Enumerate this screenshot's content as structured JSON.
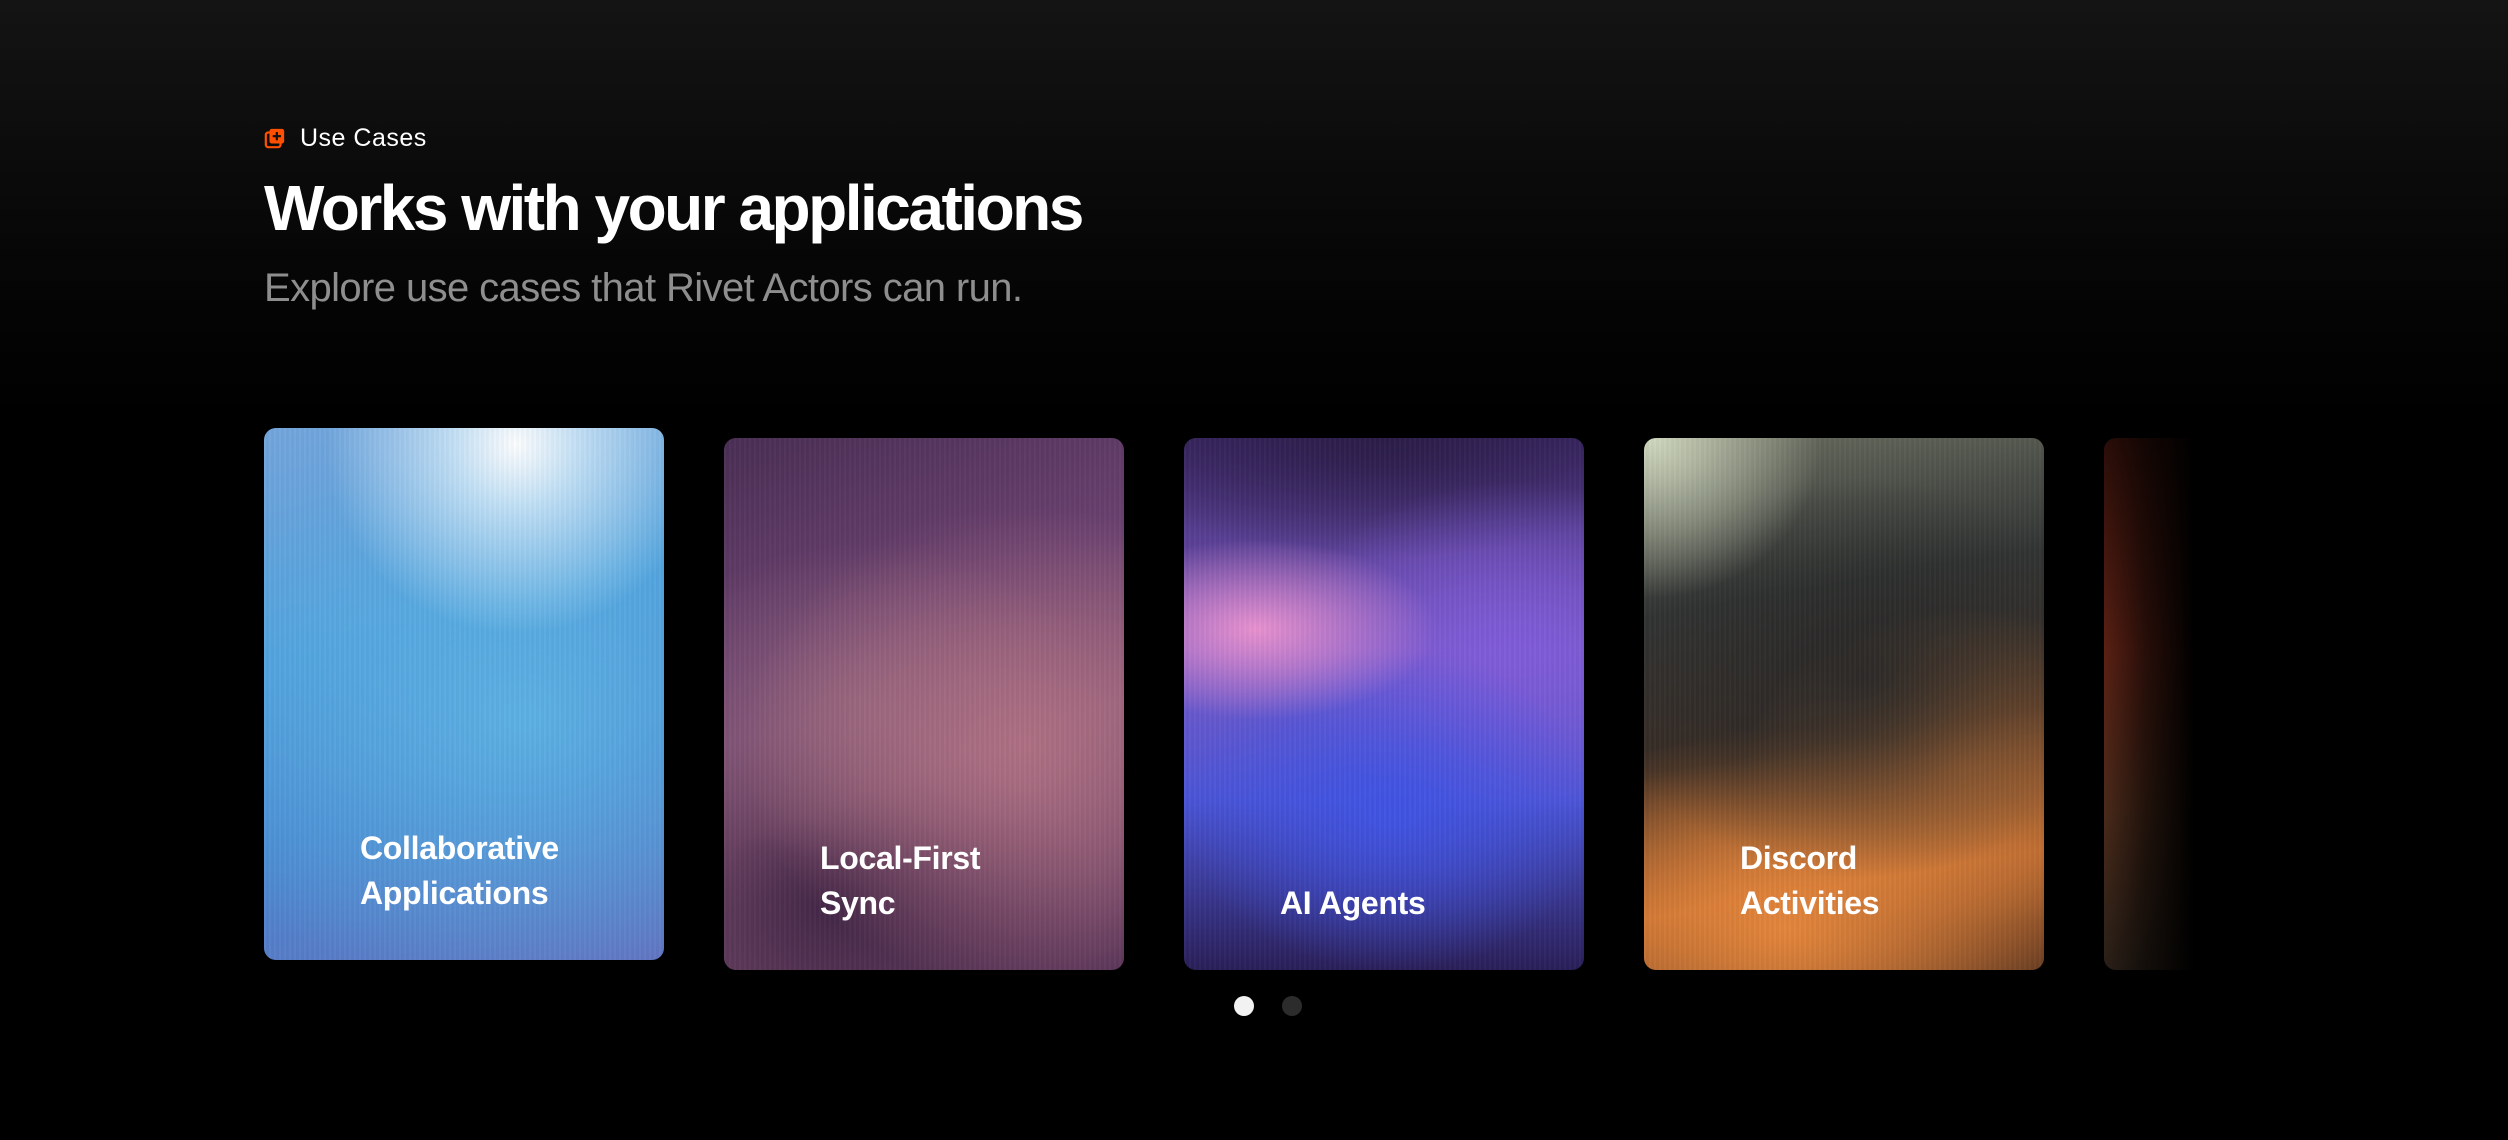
{
  "section": {
    "eyebrow": "Use Cases",
    "eyebrow_icon": "square-plus-icon",
    "accent_color": "#ff4f00",
    "title": "Works with your applications",
    "subtitle": "Explore use cases that Rivet Actors can run."
  },
  "cards": [
    {
      "title": "Collaborative\nApplications",
      "palette": "blue-white"
    },
    {
      "title": "Local-First\nSync",
      "palette": "plum-rose"
    },
    {
      "title": "AI Agents",
      "palette": "violet-pink-blue"
    },
    {
      "title": "Discord\nActivities",
      "palette": "charcoal-orange"
    },
    {
      "title": "",
      "palette": "dark-red"
    }
  ],
  "pagination": {
    "count": 2,
    "active_index": 0
  }
}
